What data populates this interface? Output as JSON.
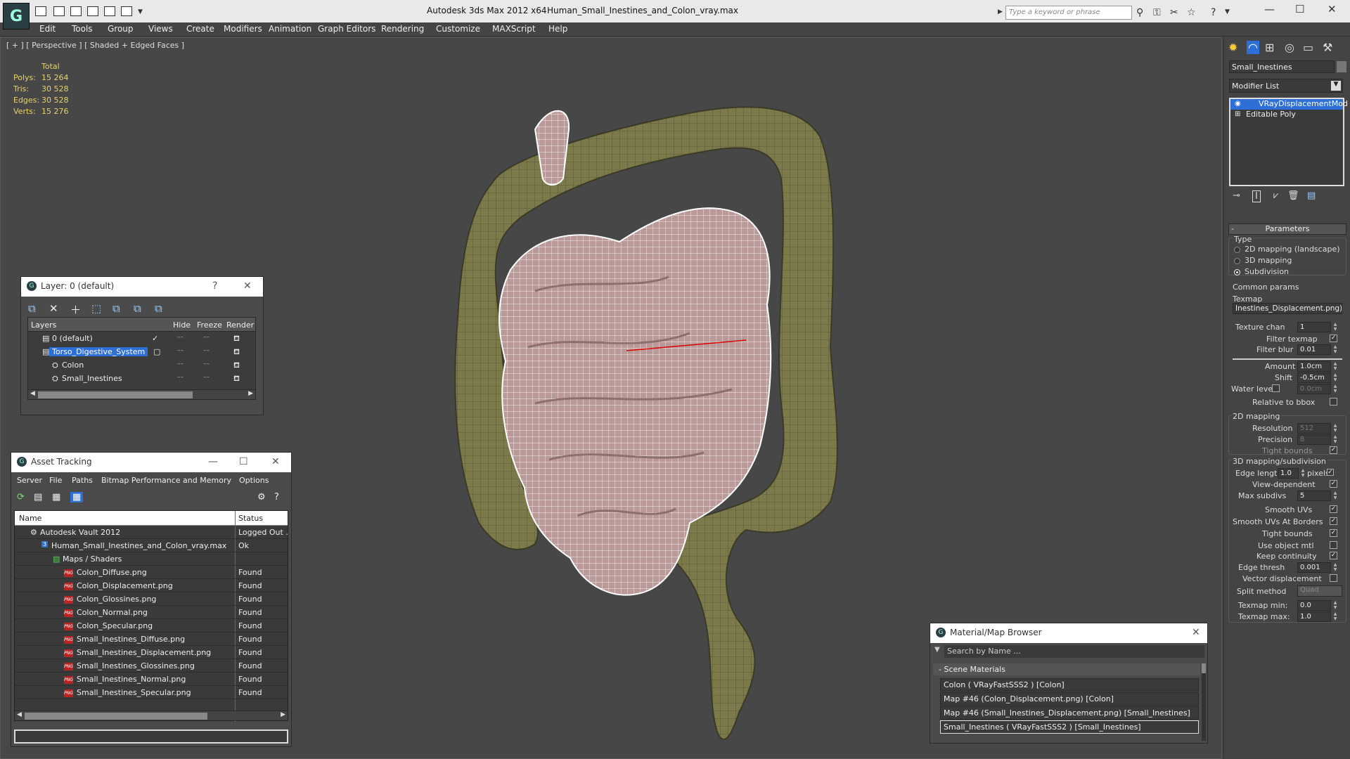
{
  "titlebar": {
    "app_title": "Autodesk 3ds Max  2012 x64",
    "file_name": "Human_Small_Inestines_and_Colon_vray.max",
    "search_placeholder": "Type a keyword or phrase"
  },
  "menu": [
    "Edit",
    "Tools",
    "Group",
    "Views",
    "Create",
    "Modifiers",
    "Animation",
    "Graph Editors",
    "Rendering",
    "Customize",
    "MAXScript",
    "Help"
  ],
  "viewport": {
    "label": "[ + ] [ Perspective ] [ Shaded + Edged Faces ]",
    "stats": {
      "header": "Total",
      "rows": [
        {
          "label": "Polys:",
          "value": "15 264"
        },
        {
          "label": "Tris:",
          "value": "30 528"
        },
        {
          "label": "Edges:",
          "value": "30 528"
        },
        {
          "label": "Verts:",
          "value": "15 276"
        }
      ]
    }
  },
  "layer_dialog": {
    "title": "Layer: 0 (default)",
    "help": "?",
    "columns": {
      "layers": "Layers",
      "hide": "Hide",
      "freeze": "Freeze",
      "render": "Render"
    },
    "rows": [
      {
        "name": "0 (default)"
      },
      {
        "name": "Torso_Digestive_System"
      },
      {
        "name": "Colon"
      },
      {
        "name": "Small_Inestines"
      }
    ]
  },
  "asset_tracking": {
    "title": "Asset Tracking",
    "menu": [
      "Server",
      "File",
      "Paths",
      "Bitmap Performance and Memory",
      "Options"
    ],
    "columns": {
      "name": "Name",
      "status": "Status"
    },
    "rows": [
      {
        "name": "Autodesk Vault 2012",
        "status": "Logged Out ."
      },
      {
        "name": "Human_Small_Inestines_and_Colon_vray.max",
        "status": "Ok"
      },
      {
        "name": "Maps / Shaders",
        "status": ""
      },
      {
        "name": "Colon_Diffuse.png",
        "status": "Found"
      },
      {
        "name": "Colon_Displacement.png",
        "status": "Found"
      },
      {
        "name": "Colon_Glossines.png",
        "status": "Found"
      },
      {
        "name": "Colon_Normal.png",
        "status": "Found"
      },
      {
        "name": "Colon_Specular.png",
        "status": "Found"
      },
      {
        "name": "Small_Inestines_Diffuse.png",
        "status": "Found"
      },
      {
        "name": "Small_Inestines_Displacement.png",
        "status": "Found"
      },
      {
        "name": "Small_Inestines_Glossines.png",
        "status": "Found"
      },
      {
        "name": "Small_Inestines_Normal.png",
        "status": "Found"
      },
      {
        "name": "Small_Inestines_Specular.png",
        "status": "Found"
      }
    ]
  },
  "material_browser": {
    "title": "Material/Map Browser",
    "search_placeholder": "Search by Name ...",
    "section": "Scene Materials",
    "items": [
      "Colon  ( VRayFastSSS2 )  [Colon]",
      "Map #46 (Colon_Displacement.png)  [Colon]",
      "Map #46 (Small_Inestines_Displacement.png)  [Small_Inestines]",
      "Small_Inestines  ( VRayFastSSS2 )  [Small_Inestines]"
    ]
  },
  "command_panel": {
    "object_name": "Small_Inestines",
    "modifier_list": "Modifier List",
    "stack": [
      "VRayDisplacementMod",
      "Editable Poly"
    ],
    "parameters": {
      "rollout_title": "Parameters",
      "type_label": "Type",
      "type_options": [
        "2D mapping (landscape)",
        "3D mapping",
        "Subdivision"
      ],
      "common_params": "Common params",
      "texmap_label": "Texmap",
      "texmap_value": "Inestines_Displacement.png)",
      "texture_chan_label": "Texture chan",
      "texture_chan": "1",
      "filter_texmap": "Filter texmap",
      "filter_blur_label": "Filter blur",
      "filter_blur": "0.01",
      "amount_label": "Amount",
      "amount": "1.0cm",
      "shift_label": "Shift",
      "shift": "-0.5cm",
      "water_level_label": "Water level",
      "water_level": "0.0cm",
      "relative_bbox": "Relative to bbox",
      "mapping2d_title": "2D mapping",
      "resolution_label": "Resolution",
      "resolution": "512",
      "precision_label": "Precision",
      "precision": "8",
      "tight_bounds": "Tight bounds",
      "mapping3d_title": "3D mapping/subdivision",
      "edge_length_label": "Edge length",
      "edge_length": "1.0",
      "pixels": "pixels",
      "view_dependent": "View-dependent",
      "max_subdivs_label": "Max subdivs",
      "max_subdivs": "5",
      "smooth_uvs": "Smooth UVs",
      "smooth_uvs_borders": "Smooth UVs At Borders",
      "tight_bounds2": "Tight bounds",
      "use_object_mtl": "Use object mtl",
      "keep_continuity": "Keep continuity",
      "edge_thresh_label": "Edge thresh",
      "edge_thresh": "0.001",
      "vector_displacement": "Vector displacement",
      "split_method_label": "Split method",
      "split_method": "Quad",
      "texmap_min_label": "Texmap min:",
      "texmap_min": "0.0",
      "texmap_max_label": "Texmap max:",
      "texmap_max": "1.0"
    }
  }
}
